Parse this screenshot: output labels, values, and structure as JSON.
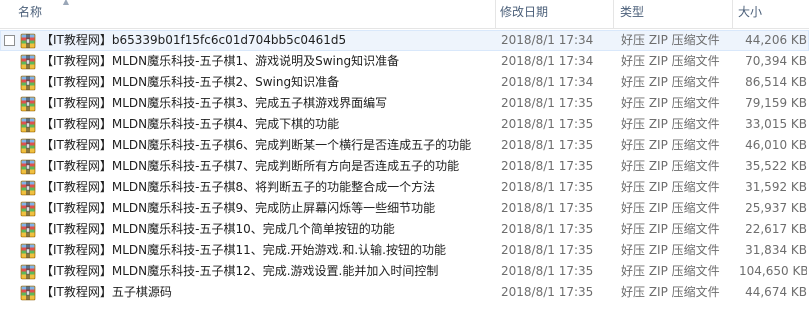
{
  "columns": {
    "name": "名称",
    "date": "修改日期",
    "type": "类型",
    "size": "大小"
  },
  "files": [
    {
      "name": "【IT教程网】b65339b01f15fc6c01d704bb5c0461d5",
      "date": "2018/8/1 17:34",
      "type": "好压 ZIP 压缩文件",
      "size": "44,206 KB",
      "selected": true
    },
    {
      "name": "【IT教程网】MLDN魔乐科技-五子棋1、游戏说明及Swing知识准备",
      "date": "2018/8/1 17:34",
      "type": "好压 ZIP 压缩文件",
      "size": "70,394 KB"
    },
    {
      "name": "【IT教程网】MLDN魔乐科技-五子棋2、Swing知识准备",
      "date": "2018/8/1 17:34",
      "type": "好压 ZIP 压缩文件",
      "size": "86,514 KB"
    },
    {
      "name": "【IT教程网】MLDN魔乐科技-五子棋3、完成五子棋游戏界面编写",
      "date": "2018/8/1 17:35",
      "type": "好压 ZIP 压缩文件",
      "size": "79,159 KB"
    },
    {
      "name": "【IT教程网】MLDN魔乐科技-五子棋4、完成下棋的功能",
      "date": "2018/8/1 17:35",
      "type": "好压 ZIP 压缩文件",
      "size": "33,015 KB"
    },
    {
      "name": "【IT教程网】MLDN魔乐科技-五子棋6、完成判断某一个横行是否连成五子的功能",
      "date": "2018/8/1 17:35",
      "type": "好压 ZIP 压缩文件",
      "size": "46,010 KB"
    },
    {
      "name": "【IT教程网】MLDN魔乐科技-五子棋7、完成判断所有方向是否连成五子的功能",
      "date": "2018/8/1 17:35",
      "type": "好压 ZIP 压缩文件",
      "size": "35,522 KB"
    },
    {
      "name": "【IT教程网】MLDN魔乐科技-五子棋8、将判断五子的功能整合成一个方法",
      "date": "2018/8/1 17:35",
      "type": "好压 ZIP 压缩文件",
      "size": "31,592 KB"
    },
    {
      "name": "【IT教程网】MLDN魔乐科技-五子棋9、完成防止屏幕闪烁等一些细节功能",
      "date": "2018/8/1 17:35",
      "type": "好压 ZIP 压缩文件",
      "size": "25,937 KB"
    },
    {
      "name": "【IT教程网】MLDN魔乐科技-五子棋10、完成几个简单按钮的功能",
      "date": "2018/8/1 17:35",
      "type": "好压 ZIP 压缩文件",
      "size": "22,617 KB"
    },
    {
      "name": "【IT教程网】MLDN魔乐科技-五子棋11、完成.开始游戏.和.认输.按钮的功能",
      "date": "2018/8/1 17:35",
      "type": "好压 ZIP 压缩文件",
      "size": "31,834 KB"
    },
    {
      "name": "【IT教程网】MLDN魔乐科技-五子棋12、完成.游戏设置.能并加入时间控制",
      "date": "2018/8/1 17:35",
      "type": "好压 ZIP 压缩文件",
      "size": "104,650 KB"
    },
    {
      "name": "【IT教程网】五子棋源码",
      "date": "2018/8/1 17:35",
      "type": "好压 ZIP 压缩文件",
      "size": "44,674 KB"
    }
  ],
  "icon": "zip-archive-icon",
  "colors": {
    "header_text": "#4c607a",
    "selected_bg": "#eef4fc",
    "selected_border": "#d9e8fb",
    "meta_text": "#6d6d6d"
  }
}
